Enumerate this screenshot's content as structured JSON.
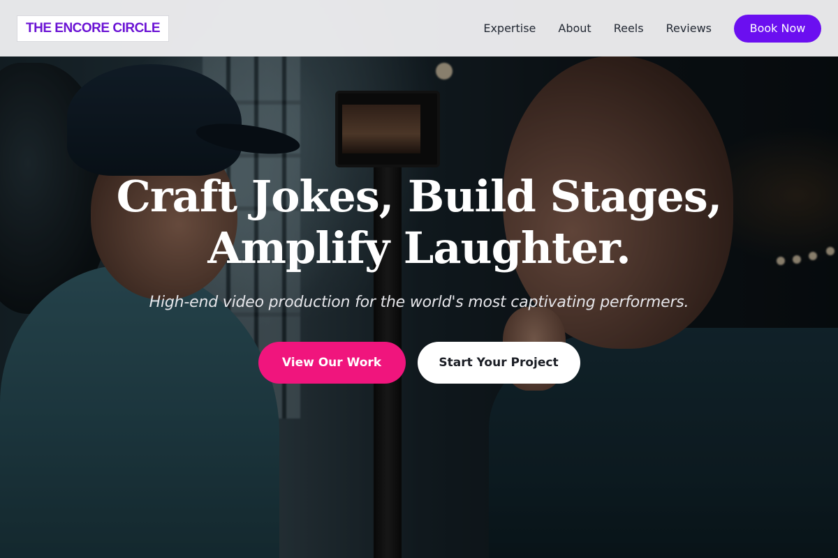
{
  "header": {
    "logo_text": "THE ENCORE CIRCLE",
    "nav": [
      {
        "label": "Expertise"
      },
      {
        "label": "About"
      },
      {
        "label": "Reels"
      },
      {
        "label": "Reviews"
      }
    ],
    "cta_label": "Book Now"
  },
  "hero": {
    "title_line1": "Craft Jokes, Build Stages,",
    "title_line2": "Amplify Laughter.",
    "subtitle": "High-end video production for the world's most captivating performers.",
    "primary_button": "View Our Work",
    "secondary_button": "Start Your Project"
  },
  "colors": {
    "brand_purple": "#6b0ff0",
    "logo_purple": "#6a12d4",
    "primary_pink": "#f0157d",
    "header_bg": "#eeeef0"
  }
}
